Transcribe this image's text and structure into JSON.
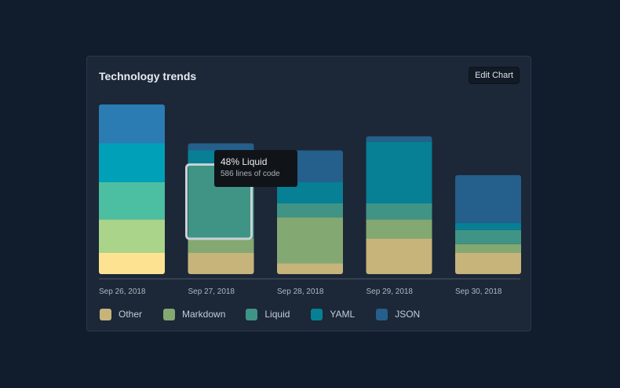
{
  "card": {
    "title": "Technology trends",
    "edit_button": "Edit Chart"
  },
  "tooltip": {
    "title": "48% Liquid",
    "subtitle": "586 lines of code"
  },
  "colors": {
    "Other": "#c7b47b",
    "Markdown": "#84a871",
    "Liquid": "#3f9486",
    "YAML": "#077f94",
    "JSON": "#255f8b"
  },
  "chart_data": {
    "type": "bar",
    "stacked": true,
    "categories": [
      "Sep 26, 2018",
      "Sep 27, 2018",
      "Sep 28, 2018",
      "Sep 29, 2018",
      "Sep 30, 2018"
    ],
    "series": [
      {
        "name": "Other",
        "values": [
          12,
          12,
          6,
          20,
          12
        ]
      },
      {
        "name": "Markdown",
        "values": [
          19,
          8,
          26,
          11,
          5
        ]
      },
      {
        "name": "Liquid",
        "values": [
          21,
          42,
          8,
          9,
          8
        ]
      },
      {
        "name": "YAML",
        "values": [
          22,
          8,
          12,
          35,
          4
        ]
      },
      {
        "name": "JSON",
        "values": [
          22,
          4,
          18,
          3,
          27
        ]
      }
    ],
    "highlight": {
      "category_index": 1,
      "series": "Liquid"
    },
    "legend_position": "bottom-left",
    "grid": false
  }
}
